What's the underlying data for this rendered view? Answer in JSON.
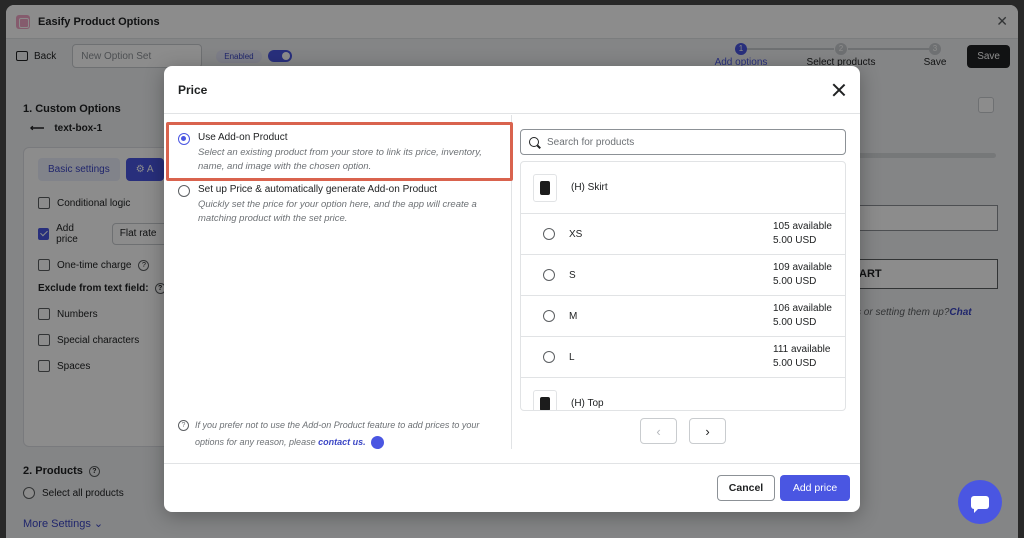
{
  "app": {
    "title": "Easify Product Options"
  },
  "toolbar": {
    "back_label": "Back",
    "name_placeholder": "New Option Set",
    "enabled_label": "Enabled",
    "steps": [
      {
        "number": "1",
        "label": "Add options"
      },
      {
        "number": "2",
        "label": "Select products"
      },
      {
        "number": "3",
        "label": "Save"
      }
    ],
    "save_label": "Save"
  },
  "background": {
    "custom_options_title": "1. Custom Options",
    "option_name": "text-box-1",
    "tab_basic": "Basic settings",
    "tab_advanced": "A",
    "conditional_logic": "Conditional logic",
    "add_price": "Add price",
    "flat_rate": "Flat rate",
    "one_time_charge": "One-time charge",
    "exclude_title": "Exclude from text field:",
    "excludes": [
      "Numbers",
      "Special characters",
      "Spaces"
    ],
    "products_title": "2. Products",
    "select_all_products": "Select all products",
    "more_settings": "More Settings",
    "right_button_text": "ART",
    "right_help_text": "s or setting them up?",
    "right_help_link": "Chat"
  },
  "modal": {
    "title": "Price",
    "option1": {
      "label": "Use Add-on Product",
      "description": "Select an existing product from your store to link its price, inventory, name, and image with the chosen option."
    },
    "option2": {
      "label": "Set up Price & automatically generate Add-on Product",
      "description": "Quickly set the price for your option here, and the app will create a matching product with the set price."
    },
    "footnote": "If you prefer not to use the Add-on Product feature to add prices to your options for any reason, please",
    "footnote_link": "contact us.",
    "search_placeholder": "Search for products",
    "products": [
      {
        "name": "(H) Skirt",
        "variants": [
          {
            "name": "XS",
            "available": "105 available",
            "price": "5.00 USD"
          },
          {
            "name": "S",
            "available": "109 available",
            "price": "5.00 USD"
          },
          {
            "name": "M",
            "available": "106 available",
            "price": "5.00 USD"
          },
          {
            "name": "L",
            "available": "111 available",
            "price": "5.00 USD"
          }
        ]
      },
      {
        "name": "(H) Top"
      }
    ],
    "pager_prev": "‹",
    "pager_next": "›",
    "cancel_label": "Cancel",
    "add_price_label": "Add price"
  },
  "colors": {
    "accent": "#4a56e2",
    "highlight": "#d9634e"
  }
}
